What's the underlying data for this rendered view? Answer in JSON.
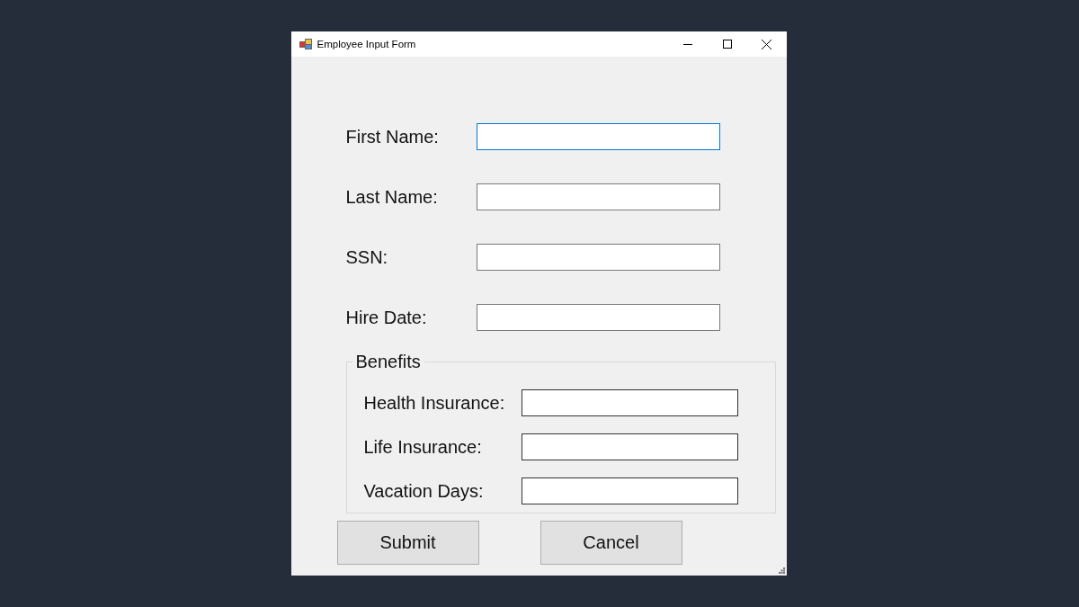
{
  "window": {
    "title": "Employee Input Form"
  },
  "fields": [
    {
      "label": "First Name:",
      "focused": true
    },
    {
      "label": "Last Name:",
      "focused": false
    },
    {
      "label": "SSN:",
      "focused": false
    },
    {
      "label": "Hire Date:",
      "focused": false
    }
  ],
  "benefits": {
    "title": "Benefits",
    "fields": [
      {
        "label": "Health Insurance:",
        "focused": false
      },
      {
        "label": "Life Insurance:",
        "focused": false
      },
      {
        "label": "Vacation Days:",
        "focused": false
      }
    ]
  },
  "buttons": [
    "Submit",
    "Cancel"
  ]
}
